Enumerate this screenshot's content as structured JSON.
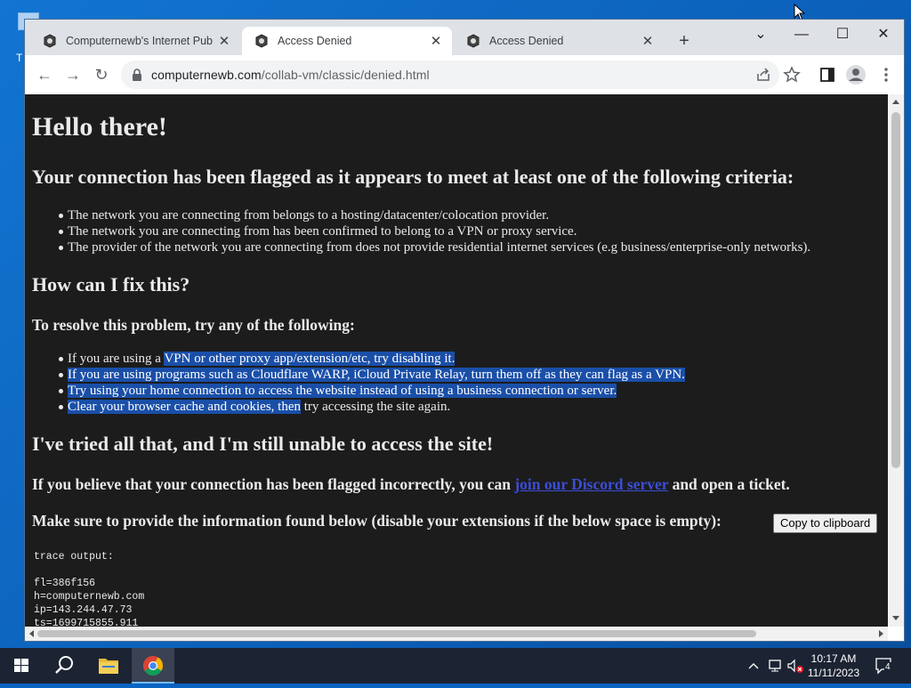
{
  "browser": {
    "tabs": [
      {
        "title": "Computernewb's Internet Pub H",
        "active": false
      },
      {
        "title": "Access Denied",
        "active": true
      },
      {
        "title": "Access Denied",
        "active": false
      }
    ],
    "url_host": "computernewb.com",
    "url_path": "/collab-vm/classic/denied.html"
  },
  "page": {
    "heading": "Hello there!",
    "flagged_heading": "Your connection has been flagged as it appears to meet at least one of the following criteria:",
    "criteria": [
      "The network you are connecting from belongs to a hosting/datacenter/colocation provider.",
      "The network you are connecting from has been confirmed to belong to a VPN or proxy service.",
      "The provider of the network you are connecting from does not provide residential internet services (e.g business/enterprise-only networks)."
    ],
    "fix_heading": "How can I fix this?",
    "resolve_intro": "To resolve this problem, try any of the following:",
    "fixes": {
      "f1_a": "If you are using a ",
      "f1_b": "VPN or other proxy app/extension/etc, try disabling it.",
      "f2": "If you are using programs such as Cloudflare WARP, iCloud Private Relay, turn them off as they can flag as a VPN.",
      "f3": "Try using your home connection to access the website instead of using a business connection or server.",
      "f4_a": "Clear your browser cache and cookies, then",
      "f4_b": " try accessing the site again."
    },
    "tried_heading": "I've tried all that, and I'm still unable to access the site!",
    "believe_a": "If you believe that your connection has been flagged incorrectly, you can ",
    "discord_link": "join our Discord server",
    "believe_b": " and open a ticket.",
    "provide_info": "Make sure to provide the information found below (disable your extensions if the below space is empty):",
    "copy_button": "Copy to clipboard",
    "trace_label": "trace output:",
    "trace_lines": [
      "fl=386f156",
      "h=computernewb.com",
      "ip=143.244.47.73",
      "ts=1699715855.911"
    ]
  },
  "taskbar": {
    "time": "10:17 AM",
    "date": "11/11/2023",
    "notifications": "4"
  },
  "colors": {
    "page_bg": "#1c1c1c",
    "selection": "#1a4fa8",
    "link": "#3b4dd8",
    "taskbar": "#1c2433"
  }
}
